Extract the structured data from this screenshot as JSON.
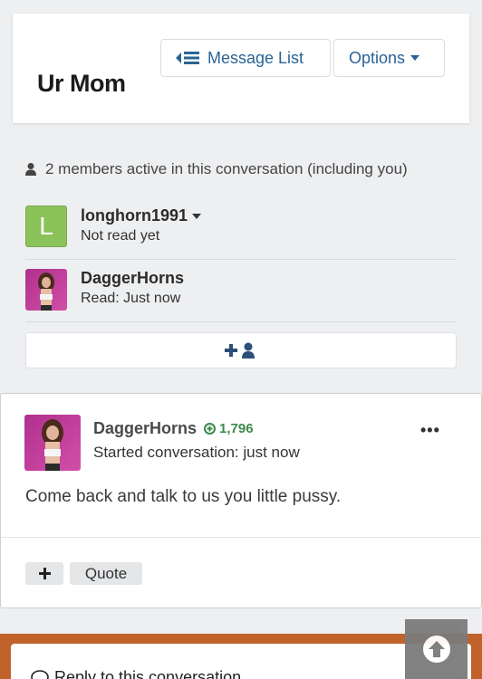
{
  "header": {
    "title": "Ur Mom",
    "message_list_label": "Message List",
    "options_label": "Options"
  },
  "members": {
    "summary": "2 members active in this conversation (including you)",
    "items": [
      {
        "name": "longhorn1991",
        "status": "Not read yet",
        "avatar_letter": "L",
        "avatar_color": "#8bc25a"
      },
      {
        "name": "DaggerHorns",
        "status": "Read: Just now"
      }
    ]
  },
  "message": {
    "author": "DaggerHorns",
    "reaction_score": "1,796",
    "meta": "Started conversation: just now",
    "body": "Come back and talk to us you little pussy.",
    "quote_label": "Quote",
    "more_label": "•••"
  },
  "reply": {
    "label": "Reply to this conversation"
  },
  "colors": {
    "link": "#2a6496",
    "reaction": "#3d8a4c",
    "reply_band": "#c0622a"
  }
}
